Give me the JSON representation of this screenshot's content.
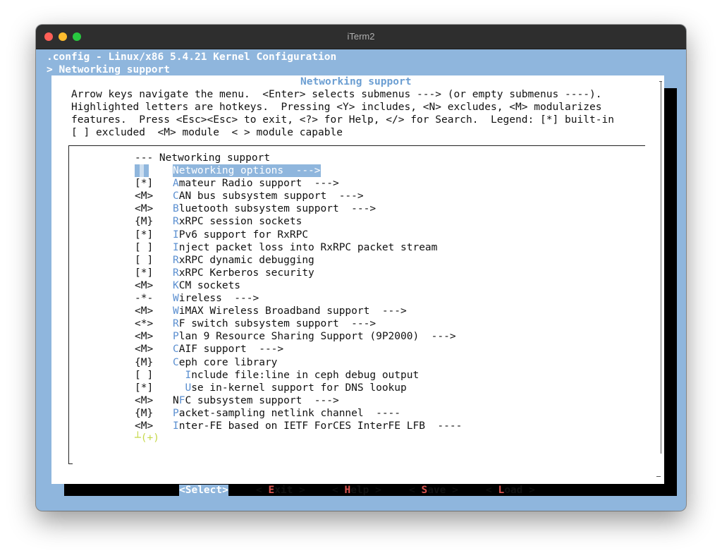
{
  "window": {
    "title": "iTerm2"
  },
  "header": {
    "line1": ".config - Linux/x86 5.4.21 Kernel Configuration",
    "line2": "> Networking support"
  },
  "dialog": {
    "title": "Networking support",
    "help": [
      "Arrow keys navigate the menu.  <Enter> selects submenus ---> (or empty submenus ----).",
      "Highlighted letters are hotkeys.  Pressing <Y> includes, <N> excludes, <M> modularizes",
      "features.  Press <Esc><Esc> to exit, <?> for Help, </> for Search.  Legend: [*] built-in",
      "[ ] excluded  <M> module  < > module capable"
    ],
    "top_line": "--- Networking support",
    "items": [
      {
        "state": "",
        "key": "N",
        "rest": "etworking options  --->",
        "selected": true
      },
      {
        "state": "[*]",
        "key": "A",
        "rest": "mateur Radio support  --->"
      },
      {
        "state": "<M>",
        "key": "C",
        "rest": "AN bus subsystem support  --->"
      },
      {
        "state": "<M>",
        "key": "B",
        "rest": "luetooth subsystem support  --->"
      },
      {
        "state": "{M}",
        "key": "R",
        "rest": "xRPC session sockets"
      },
      {
        "state": "[*]",
        "key": "I",
        "rest": "Pv6 support for RxRPC"
      },
      {
        "state": "[ ]",
        "key": "I",
        "rest": "nject packet loss into RxRPC packet stream"
      },
      {
        "state": "[ ]",
        "key": "R",
        "rest": "xRPC dynamic debugging"
      },
      {
        "state": "[*]",
        "key": "R",
        "rest": "xRPC Kerberos security"
      },
      {
        "state": "<M>",
        "key": "K",
        "rest": "CM sockets"
      },
      {
        "state": "-*-",
        "key": "W",
        "rest": "ireless  --->"
      },
      {
        "state": "<M>",
        "key": "W",
        "rest": "iMAX Wireless Broadband support  --->"
      },
      {
        "state": "<*>",
        "key": "R",
        "rest": "F switch subsystem support  --->"
      },
      {
        "state": "<M>",
        "key": "P",
        "rest": "lan 9 Resource Sharing Support (9P2000)  --->"
      },
      {
        "state": "<M>",
        "key": "C",
        "rest": "AIF support  --->"
      },
      {
        "state": "{M}",
        "key": "C",
        "rest": "eph core library"
      },
      {
        "state": "[ ]",
        "pre": "  ",
        "key": "I",
        "rest": "nclude file:line in ceph debug output"
      },
      {
        "state": "[*]",
        "pre": "  ",
        "key": "U",
        "rest": "se in-kernel support for DNS lookup"
      },
      {
        "state": "<M>",
        "pre": "N",
        "key": "F",
        "rest": "C subsystem support  --->"
      },
      {
        "state": "{M}",
        "key": "P",
        "rest": "acket-sampling netlink channel  ----"
      },
      {
        "state": "<M>",
        "key": "I",
        "rest": "nter-FE based on IETF ForCES InterFE LFB  ----"
      }
    ],
    "more": "(+)",
    "buttons": [
      {
        "label": "<Select>",
        "selected": true
      },
      {
        "pre": "< ",
        "key": "E",
        "rest": "xit",
        "post": " >"
      },
      {
        "pre": "< ",
        "key": "H",
        "rest": "elp",
        "post": " >"
      },
      {
        "pre": "< ",
        "key": "S",
        "rest": "ave",
        "post": " >"
      },
      {
        "pre": "< ",
        "key": "L",
        "rest": "oad",
        "post": " >"
      }
    ]
  },
  "colors": {
    "terminal_bg": "#8fb6dd",
    "hotkey": "#5b8fd0",
    "button_hotkey": "#d9534f",
    "more_indicator": "#c6d84a"
  }
}
